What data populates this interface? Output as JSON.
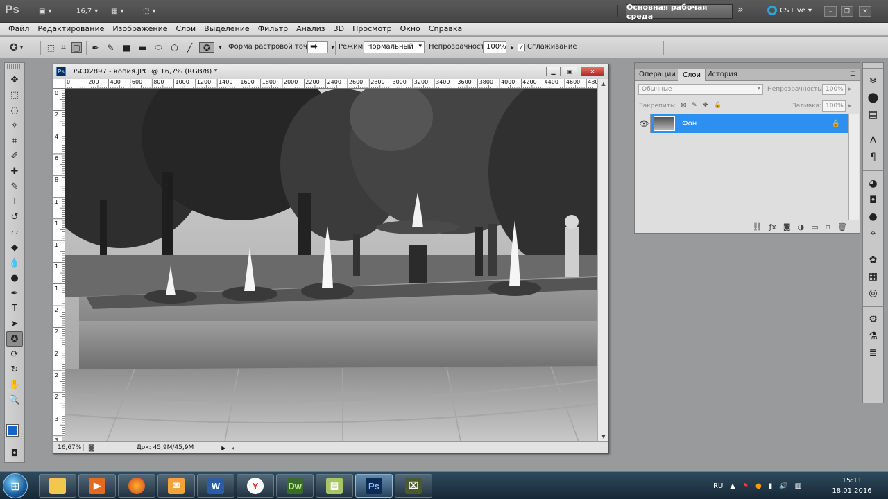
{
  "app": {
    "logo": "Ps",
    "zoom_value": "16,7",
    "workspace": "Основная рабочая среда",
    "more": "»",
    "cs_live": "CS Live"
  },
  "menu": [
    "Файл",
    "Редактирование",
    "Изображение",
    "Слои",
    "Выделение",
    "Фильтр",
    "Анализ",
    "3D",
    "Просмотр",
    "Окно",
    "Справка"
  ],
  "options": {
    "brush_shape_label": "Форма растровой точки:",
    "mode_label": "Режим:",
    "mode_value": "Нормальный",
    "opacity_label": "Непрозрачность:",
    "opacity_value": "100%",
    "smoothing_label": "Сглаживание"
  },
  "document": {
    "title": "DSC02897 - копия.JPG @ 16,7% (RGB/8) *",
    "ruler_h": [
      "0",
      "200",
      "400",
      "600",
      "800",
      "1000",
      "1200",
      "1400",
      "1600",
      "1800",
      "2000",
      "2200",
      "2400",
      "2600",
      "2800",
      "3000",
      "3200",
      "3400",
      "3600",
      "3800",
      "4000",
      "4200",
      "4400",
      "4600",
      "480"
    ],
    "ruler_v": [
      "0",
      "2",
      "4",
      "6",
      "8",
      "1",
      "1",
      "1",
      "1",
      "1",
      "2",
      "2",
      "2",
      "2",
      "2",
      "3",
      "3"
    ],
    "zoom": "16,67%",
    "doc_info": "Док: 45,9M/45,9M"
  },
  "layers_panel": {
    "tabs": [
      "Операции",
      "Слои",
      "История"
    ],
    "active_tab": "Слои",
    "blend_mode": "Обычные",
    "opacity_label": "Непрозрачность:",
    "opacity_value": "100%",
    "lock_label": "Закрепить:",
    "fill_label": "Заливка:",
    "fill_value": "100%",
    "layer_name": "Фон"
  },
  "taskbar": {
    "apps": [
      "explorer",
      "media-player",
      "firefox",
      "outlook",
      "word",
      "yandex",
      "dreamweaver",
      "notes",
      "photoshop",
      "camera"
    ],
    "app_glyphs": {
      "word": "W",
      "dreamweaver": "Dw",
      "photoshop": "Ps",
      "yandex": "Y"
    },
    "language": "RU",
    "time": "15:11",
    "date": "18.01.2016"
  },
  "colors": {
    "foreground": "#1863c8",
    "background": "#ffffff",
    "selection": "#2d8ff0"
  }
}
